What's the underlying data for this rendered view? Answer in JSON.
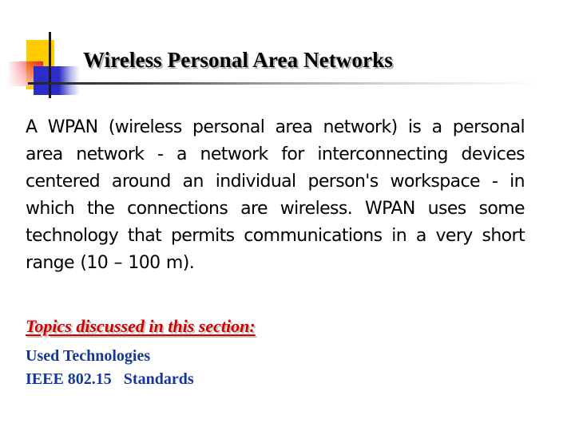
{
  "slide": {
    "title": "Wireless Personal Area Networks",
    "body": "A WPAN (wireless personal area network) is a personal area network - a network for interconnecting devices centered around an individual person's workspace - in which the connections are wireless. WPAN uses some technology that permits communications in a very short range (10 – 100 m).",
    "topics_heading": "Topics discussed in this section:",
    "topics": [
      "Used Technologies",
      "IEEE 802.15   Standards"
    ]
  },
  "colors": {
    "title": "#000000",
    "body": "#000000",
    "topics_heading": "#d00000",
    "topics": "#15379b",
    "logo_yellow": "#ffcc00",
    "logo_red": "#ee1c24",
    "logo_blue": "#2c2cc8"
  }
}
